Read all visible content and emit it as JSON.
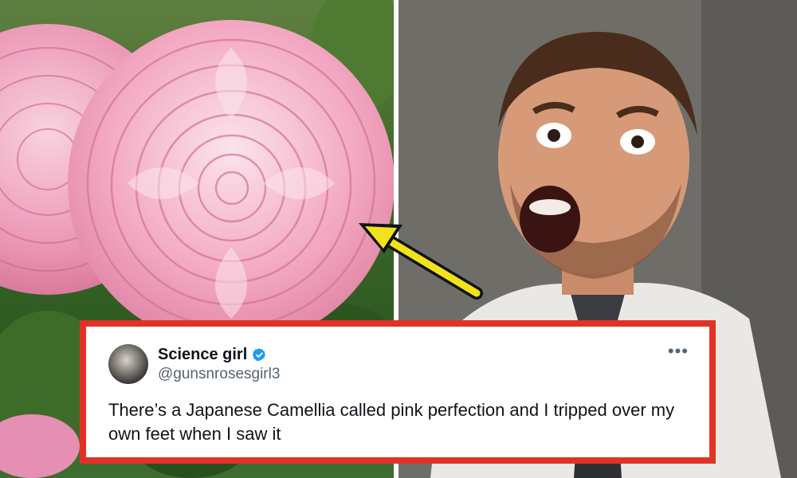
{
  "tweet": {
    "display_name": "Science girl",
    "handle": "@gunsnrosesgirl3",
    "text": "There’s a Japanese Camellia called pink perfection and I tripped over my own feet when I saw it",
    "more_label": "•••"
  },
  "icons": {
    "verified": "verified-badge-icon",
    "more": "more-options-icon",
    "arrow": "arrow-icon"
  },
  "colors": {
    "frame_red": "#e03326",
    "verified_blue": "#1d9bf0",
    "arrow_yellow": "#f2e21a",
    "flower_pink": "#f3a8c2"
  }
}
